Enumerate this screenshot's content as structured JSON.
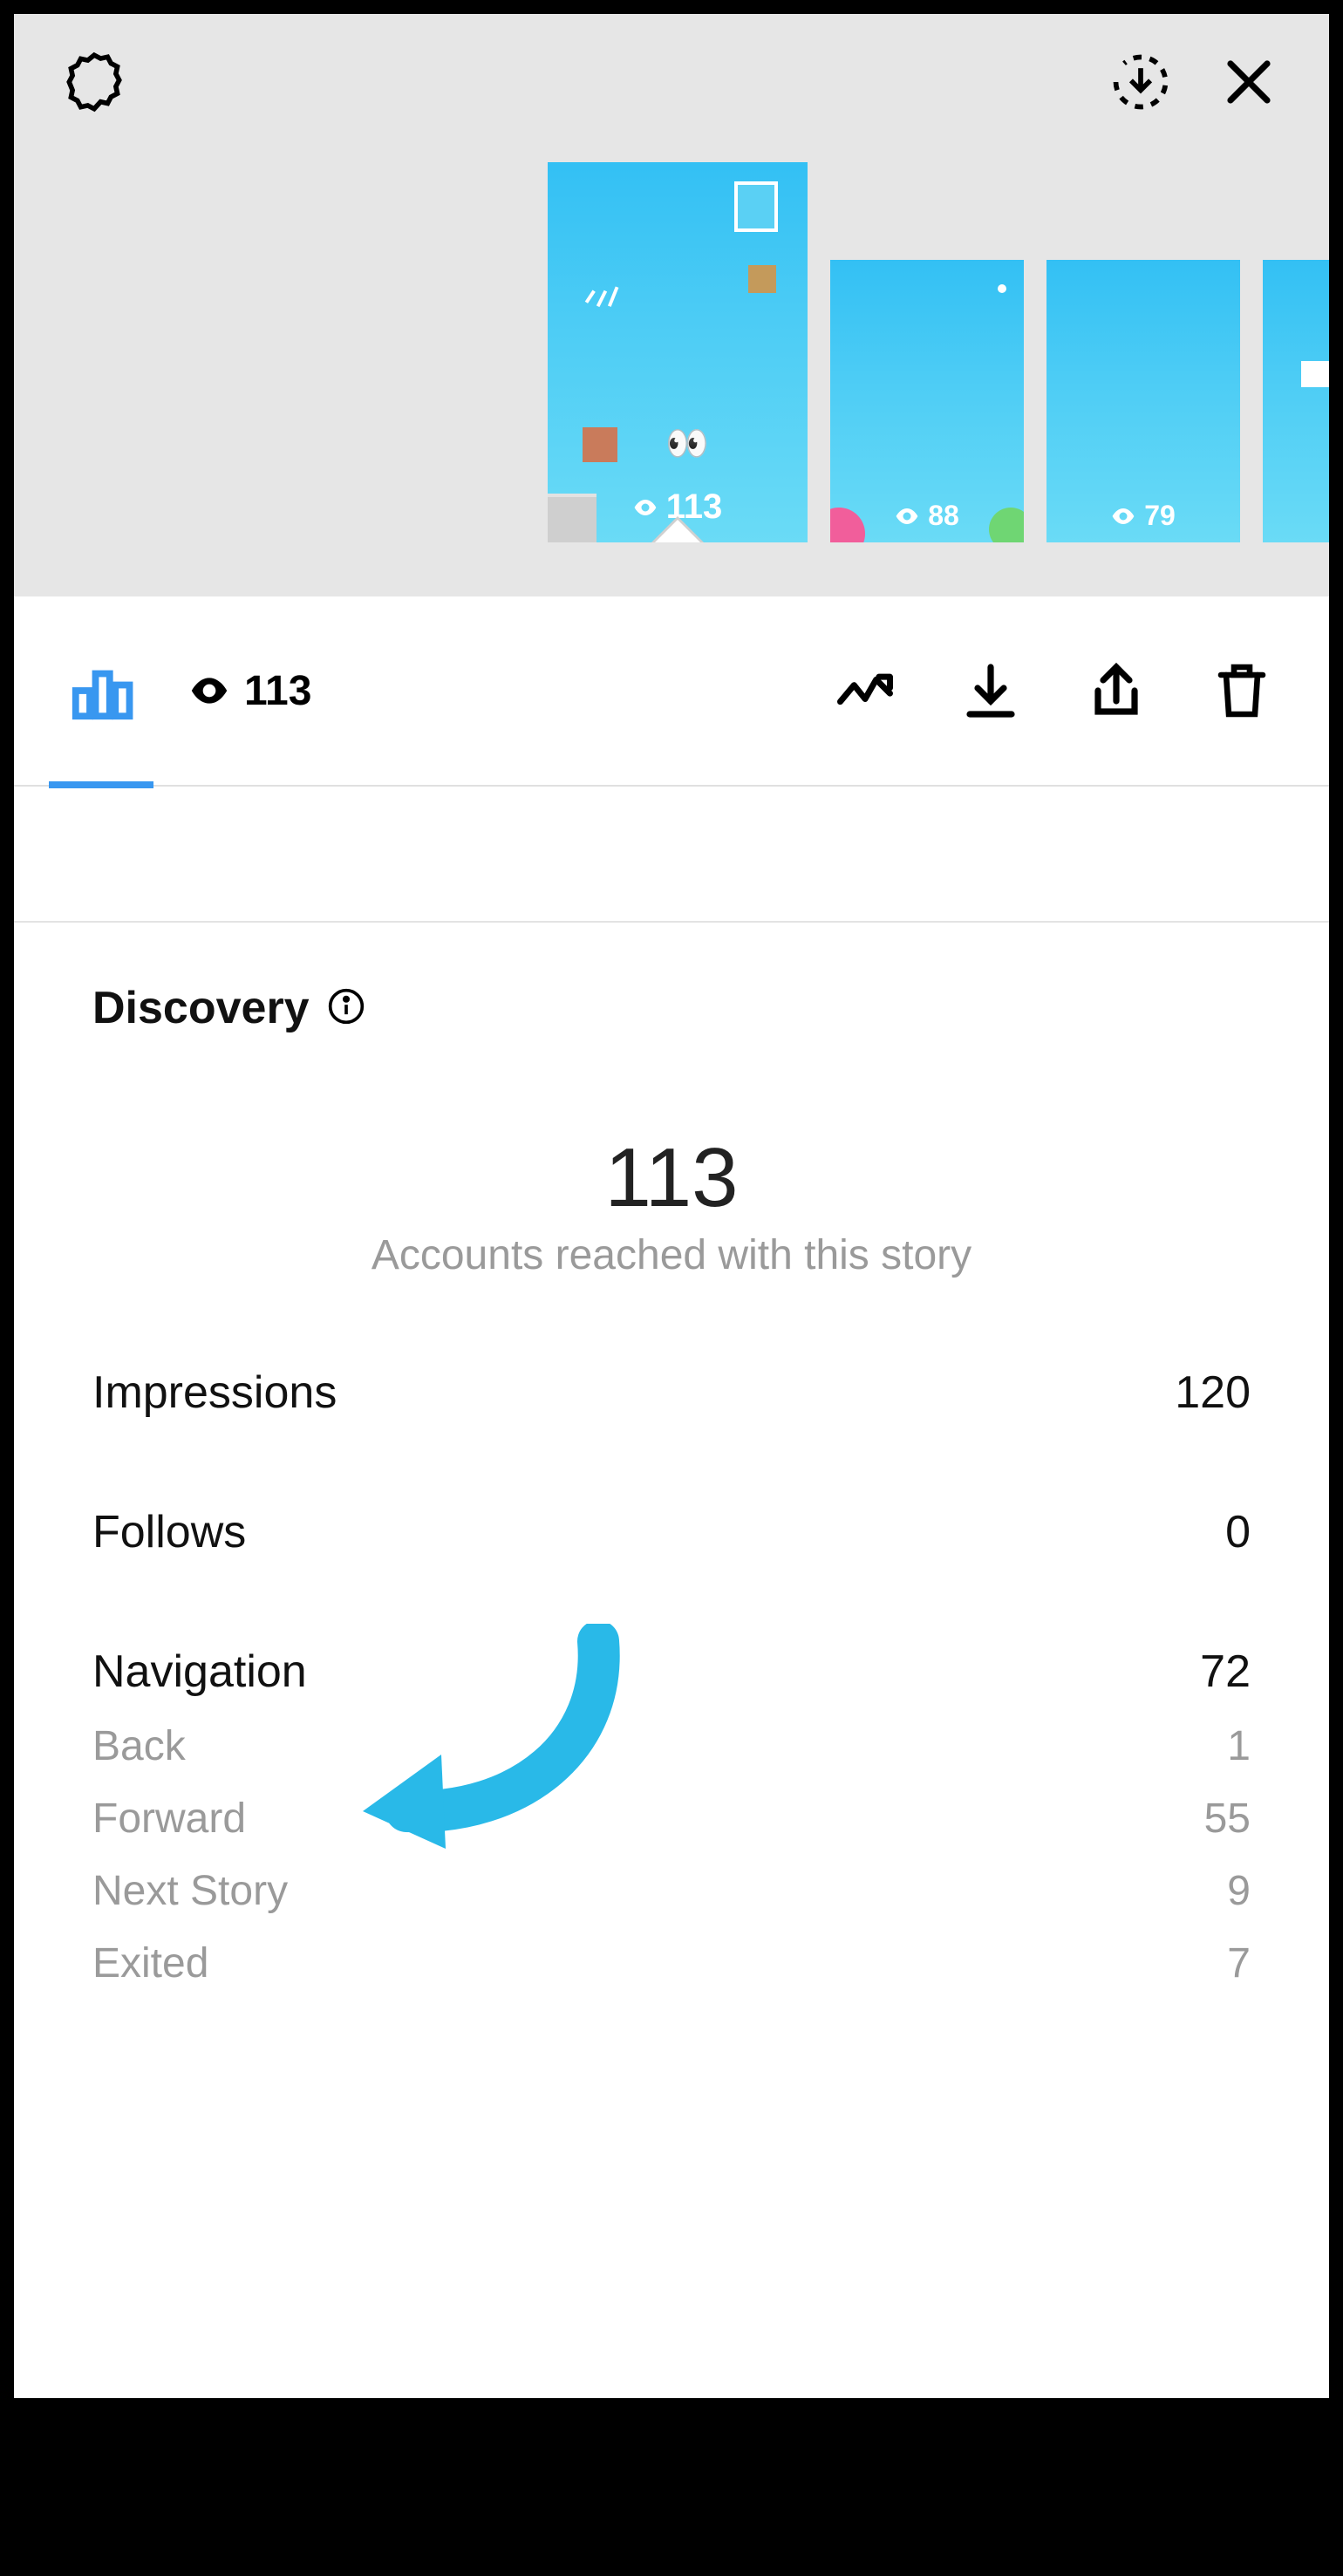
{
  "stories": [
    {
      "views": "113"
    },
    {
      "views": "88"
    },
    {
      "views": "79"
    },
    {
      "views": ""
    }
  ],
  "toolbar": {
    "view_count": "113"
  },
  "discovery": {
    "title": "Discovery",
    "big_number": "113",
    "subtitle": "Accounts reached with this story",
    "rows": {
      "impressions": {
        "label": "Impressions",
        "value": "120"
      },
      "follows": {
        "label": "Follows",
        "value": "0"
      },
      "navigation": {
        "label": "Navigation",
        "value": "72"
      }
    },
    "nav_detail": [
      {
        "label": "Back",
        "value": "1"
      },
      {
        "label": "Forward",
        "value": "55"
      },
      {
        "label": "Next Story",
        "value": "9"
      },
      {
        "label": "Exited",
        "value": "7"
      }
    ]
  }
}
